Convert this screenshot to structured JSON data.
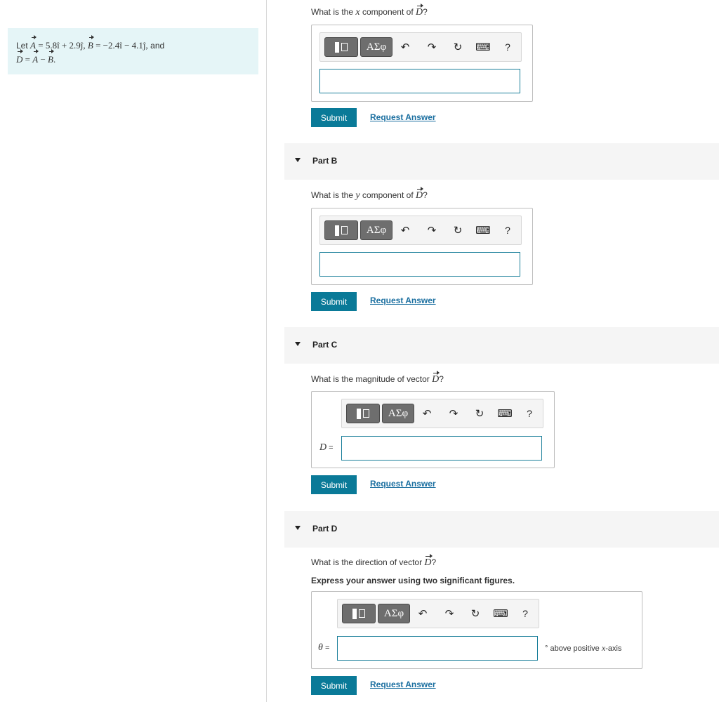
{
  "problem": {
    "let": "Let",
    "a_name": "A",
    "a_expr": "= 5.8î + 2.9ĵ,",
    "b_name": "B",
    "b_expr": "= −2.4î − 4.1ĵ,",
    "and": "and",
    "d_name": "D",
    "d_expr_1": "=",
    "d_a": "A",
    "d_minus": "−",
    "d_b": "B",
    "d_end": "."
  },
  "toolbar": {
    "greek_label": "ΑΣφ",
    "undo_icon": "undo-icon",
    "redo_icon": "redo-icon",
    "reset_icon": "reset-icon",
    "keyboard_icon": "keyboard-icon",
    "help_label": "?"
  },
  "buttons": {
    "submit": "Submit",
    "request": "Request Answer"
  },
  "partA": {
    "q_prefix": "What is the",
    "q_var": "x",
    "q_mid": "component of",
    "q_vec": "D",
    "q_end": "?",
    "value": ""
  },
  "partB": {
    "title": "Part B",
    "q_prefix": "What is the",
    "q_var": "y",
    "q_mid": "component of",
    "q_vec": "D",
    "q_end": "?",
    "value": ""
  },
  "partC": {
    "title": "Part C",
    "q_prefix": "What is the magnitude of vector",
    "q_vec": "D",
    "q_end": "?",
    "label_var": "D",
    "label_eq": " =",
    "value": ""
  },
  "partD": {
    "title": "Part D",
    "q_prefix": "What is the direction of vector",
    "q_vec": "D",
    "q_end": "?",
    "note": "Express your answer using two significant figures.",
    "label_var": "θ",
    "label_eq": " =",
    "value": "",
    "unit_deg": "°",
    "unit_prefix": "above positive",
    "unit_var": "x",
    "unit_suffix": "-axis"
  }
}
